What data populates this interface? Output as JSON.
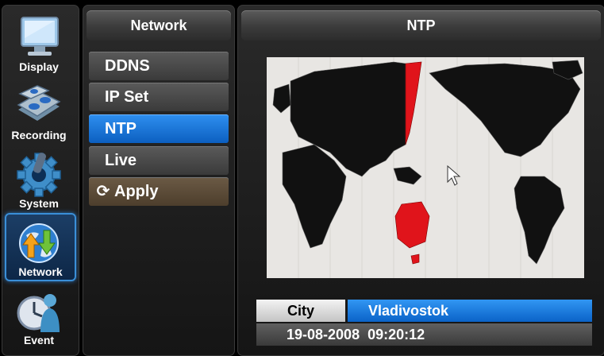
{
  "sidebar": {
    "items": [
      {
        "label": "Display",
        "icon": "monitor-icon",
        "active": false
      },
      {
        "label": "Recording",
        "icon": "recording-disks-icon",
        "active": false
      },
      {
        "label": "System",
        "icon": "gear-icon",
        "active": false
      },
      {
        "label": "Network",
        "icon": "network-globe-icon",
        "active": true
      },
      {
        "label": "Event",
        "icon": "clock-person-icon",
        "active": false
      }
    ]
  },
  "network_menu": {
    "title": "Network",
    "items": [
      {
        "label": "DDNS",
        "active": false
      },
      {
        "label": "IP Set",
        "active": false
      },
      {
        "label": "NTP",
        "active": true
      },
      {
        "label": "Live",
        "active": false
      }
    ],
    "apply_label": "Apply"
  },
  "ntp": {
    "title": "NTP",
    "city_label": "City",
    "city_value": "Vladivostok",
    "datetime": "19-08-2008  09:20:12"
  },
  "colors": {
    "accent": "#1677e0",
    "highlight_zone": "#e0141b",
    "land": "#111111"
  }
}
